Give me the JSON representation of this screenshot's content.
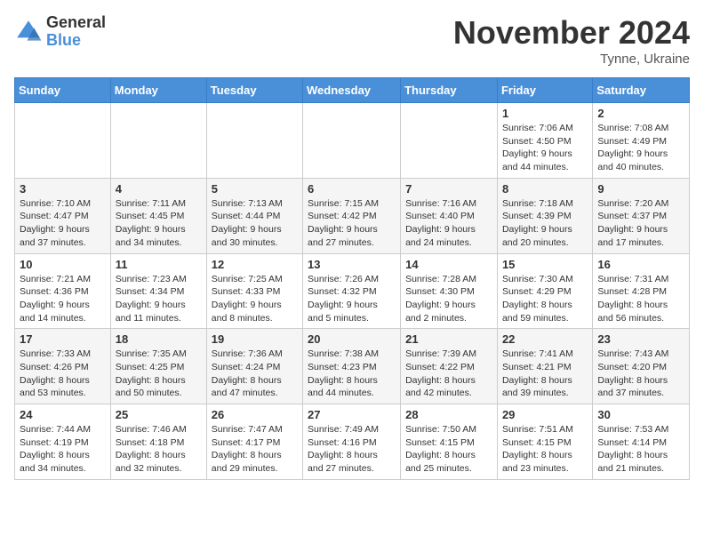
{
  "header": {
    "logo_general": "General",
    "logo_blue": "Blue",
    "month_title": "November 2024",
    "location": "Tynne, Ukraine"
  },
  "days_of_week": [
    "Sunday",
    "Monday",
    "Tuesday",
    "Wednesday",
    "Thursday",
    "Friday",
    "Saturday"
  ],
  "weeks": [
    [
      {
        "day": "",
        "info": ""
      },
      {
        "day": "",
        "info": ""
      },
      {
        "day": "",
        "info": ""
      },
      {
        "day": "",
        "info": ""
      },
      {
        "day": "",
        "info": ""
      },
      {
        "day": "1",
        "info": "Sunrise: 7:06 AM\nSunset: 4:50 PM\nDaylight: 9 hours and 44 minutes."
      },
      {
        "day": "2",
        "info": "Sunrise: 7:08 AM\nSunset: 4:49 PM\nDaylight: 9 hours and 40 minutes."
      }
    ],
    [
      {
        "day": "3",
        "info": "Sunrise: 7:10 AM\nSunset: 4:47 PM\nDaylight: 9 hours and 37 minutes."
      },
      {
        "day": "4",
        "info": "Sunrise: 7:11 AM\nSunset: 4:45 PM\nDaylight: 9 hours and 34 minutes."
      },
      {
        "day": "5",
        "info": "Sunrise: 7:13 AM\nSunset: 4:44 PM\nDaylight: 9 hours and 30 minutes."
      },
      {
        "day": "6",
        "info": "Sunrise: 7:15 AM\nSunset: 4:42 PM\nDaylight: 9 hours and 27 minutes."
      },
      {
        "day": "7",
        "info": "Sunrise: 7:16 AM\nSunset: 4:40 PM\nDaylight: 9 hours and 24 minutes."
      },
      {
        "day": "8",
        "info": "Sunrise: 7:18 AM\nSunset: 4:39 PM\nDaylight: 9 hours and 20 minutes."
      },
      {
        "day": "9",
        "info": "Sunrise: 7:20 AM\nSunset: 4:37 PM\nDaylight: 9 hours and 17 minutes."
      }
    ],
    [
      {
        "day": "10",
        "info": "Sunrise: 7:21 AM\nSunset: 4:36 PM\nDaylight: 9 hours and 14 minutes."
      },
      {
        "day": "11",
        "info": "Sunrise: 7:23 AM\nSunset: 4:34 PM\nDaylight: 9 hours and 11 minutes."
      },
      {
        "day": "12",
        "info": "Sunrise: 7:25 AM\nSunset: 4:33 PM\nDaylight: 9 hours and 8 minutes."
      },
      {
        "day": "13",
        "info": "Sunrise: 7:26 AM\nSunset: 4:32 PM\nDaylight: 9 hours and 5 minutes."
      },
      {
        "day": "14",
        "info": "Sunrise: 7:28 AM\nSunset: 4:30 PM\nDaylight: 9 hours and 2 minutes."
      },
      {
        "day": "15",
        "info": "Sunrise: 7:30 AM\nSunset: 4:29 PM\nDaylight: 8 hours and 59 minutes."
      },
      {
        "day": "16",
        "info": "Sunrise: 7:31 AM\nSunset: 4:28 PM\nDaylight: 8 hours and 56 minutes."
      }
    ],
    [
      {
        "day": "17",
        "info": "Sunrise: 7:33 AM\nSunset: 4:26 PM\nDaylight: 8 hours and 53 minutes."
      },
      {
        "day": "18",
        "info": "Sunrise: 7:35 AM\nSunset: 4:25 PM\nDaylight: 8 hours and 50 minutes."
      },
      {
        "day": "19",
        "info": "Sunrise: 7:36 AM\nSunset: 4:24 PM\nDaylight: 8 hours and 47 minutes."
      },
      {
        "day": "20",
        "info": "Sunrise: 7:38 AM\nSunset: 4:23 PM\nDaylight: 8 hours and 44 minutes."
      },
      {
        "day": "21",
        "info": "Sunrise: 7:39 AM\nSunset: 4:22 PM\nDaylight: 8 hours and 42 minutes."
      },
      {
        "day": "22",
        "info": "Sunrise: 7:41 AM\nSunset: 4:21 PM\nDaylight: 8 hours and 39 minutes."
      },
      {
        "day": "23",
        "info": "Sunrise: 7:43 AM\nSunset: 4:20 PM\nDaylight: 8 hours and 37 minutes."
      }
    ],
    [
      {
        "day": "24",
        "info": "Sunrise: 7:44 AM\nSunset: 4:19 PM\nDaylight: 8 hours and 34 minutes."
      },
      {
        "day": "25",
        "info": "Sunrise: 7:46 AM\nSunset: 4:18 PM\nDaylight: 8 hours and 32 minutes."
      },
      {
        "day": "26",
        "info": "Sunrise: 7:47 AM\nSunset: 4:17 PM\nDaylight: 8 hours and 29 minutes."
      },
      {
        "day": "27",
        "info": "Sunrise: 7:49 AM\nSunset: 4:16 PM\nDaylight: 8 hours and 27 minutes."
      },
      {
        "day": "28",
        "info": "Sunrise: 7:50 AM\nSunset: 4:15 PM\nDaylight: 8 hours and 25 minutes."
      },
      {
        "day": "29",
        "info": "Sunrise: 7:51 AM\nSunset: 4:15 PM\nDaylight: 8 hours and 23 minutes."
      },
      {
        "day": "30",
        "info": "Sunrise: 7:53 AM\nSunset: 4:14 PM\nDaylight: 8 hours and 21 minutes."
      }
    ]
  ]
}
